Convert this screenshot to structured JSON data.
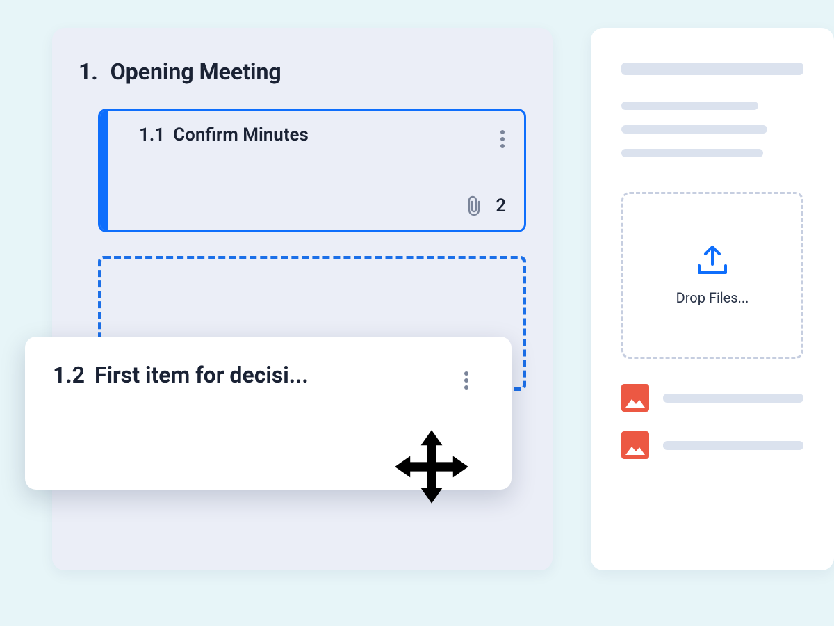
{
  "agenda": {
    "section_number": "1.",
    "section_title": "Opening Meeting",
    "items": [
      {
        "number": "1.1",
        "title": "Confirm Minutes",
        "attachment_count": "2"
      },
      {
        "number": "1.2",
        "title": "First item for decisi..."
      }
    ]
  },
  "side": {
    "dropzone_label": "Drop Files..."
  }
}
